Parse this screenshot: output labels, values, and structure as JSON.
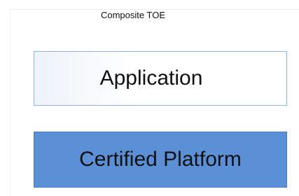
{
  "diagram": {
    "title": "Composite TOE",
    "layers": [
      {
        "label": "Application",
        "fill": "#ffffff",
        "border": "#8eb4e3"
      },
      {
        "label": "Certified Platform",
        "fill": "#5b8fd6",
        "border": "#4a7ab5"
      }
    ]
  }
}
